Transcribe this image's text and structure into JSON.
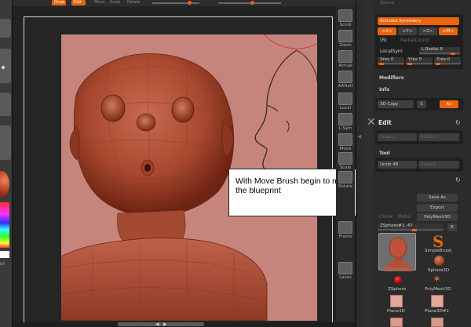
{
  "topbar": {
    "left_buttons": [
      "Draw",
      "Edit"
    ],
    "menu": [
      "Move",
      "Scale",
      "Rotate"
    ]
  },
  "callout": {
    "text": "With Move Brush begin to match mesh on the blueprint"
  },
  "left_strip": {
    "label": "or"
  },
  "toolbar": {
    "items": [
      {
        "label": "Scroll",
        "icon": "scroll-icon"
      },
      {
        "label": "Zoom",
        "icon": "zoom-icon"
      },
      {
        "label": "Actual",
        "icon": "actual-size-icon"
      },
      {
        "label": "AAHalf",
        "icon": "aahalf-icon"
      },
      {
        "label": "Local",
        "icon": "local-icon"
      },
      {
        "label": "L.Sym",
        "icon": "local-symmetry-icon"
      },
      {
        "label": "Move",
        "icon": "move-icon"
      },
      {
        "label": "Scale",
        "icon": "scale-icon"
      },
      {
        "label": "Rotate",
        "icon": "rotate-icon"
      },
      {
        "label": "Frame",
        "icon": "frame-icon"
      },
      {
        "label": "Lasso",
        "icon": "lasso-icon"
      }
    ]
  },
  "panel": {
    "top_label": "Xpose",
    "symmetry": {
      "activate": "Activate Symmetry",
      "axes": [
        ">X<",
        ">Y<",
        ">Z<",
        ">M<"
      ],
      "radial_r": "(R)",
      "radial_count": "RadialCount",
      "local_sym": "LocalSym",
      "l_radial": "L.Radial 8",
      "xres": "Xres 0",
      "yres": "Yres 0",
      "zres": "Zres 0"
    },
    "modifiers": "Modifiers",
    "info": "Info",
    "copy_3d": "3D Copy",
    "s_label": "S",
    "ai_label": "A.I",
    "edit": {
      "header": "Edit",
      "undo": "Undo 1",
      "redo": "REDO 0"
    },
    "tool": {
      "header": "Tool",
      "undo": "Undo 48",
      "redo": "Redo 0"
    },
    "buttons": {
      "save_as": "Save As",
      "export": "Export",
      "left_a": "Clone",
      "left_b": "Make",
      "polymesh": "PolyMesh3D"
    },
    "zsphere": {
      "name": "ZSphere#1. 47",
      "r_label": "R"
    },
    "thumbs": [
      {
        "caption": "ZSphere#1"
      },
      {
        "caption": "SimpleBrush"
      },
      {
        "caption": "Sphere3D"
      },
      {
        "caption": "ZSphere"
      },
      {
        "caption": "PolyMesh3D"
      },
      {
        "caption": "Plane3D"
      },
      {
        "caption": "Plane3D#1"
      }
    ]
  },
  "colors": {
    "accent": "#e8640e",
    "viewport_bg": "#c6857c",
    "mesh": "#b8573f",
    "panel_bg": "#2b2b2b"
  }
}
